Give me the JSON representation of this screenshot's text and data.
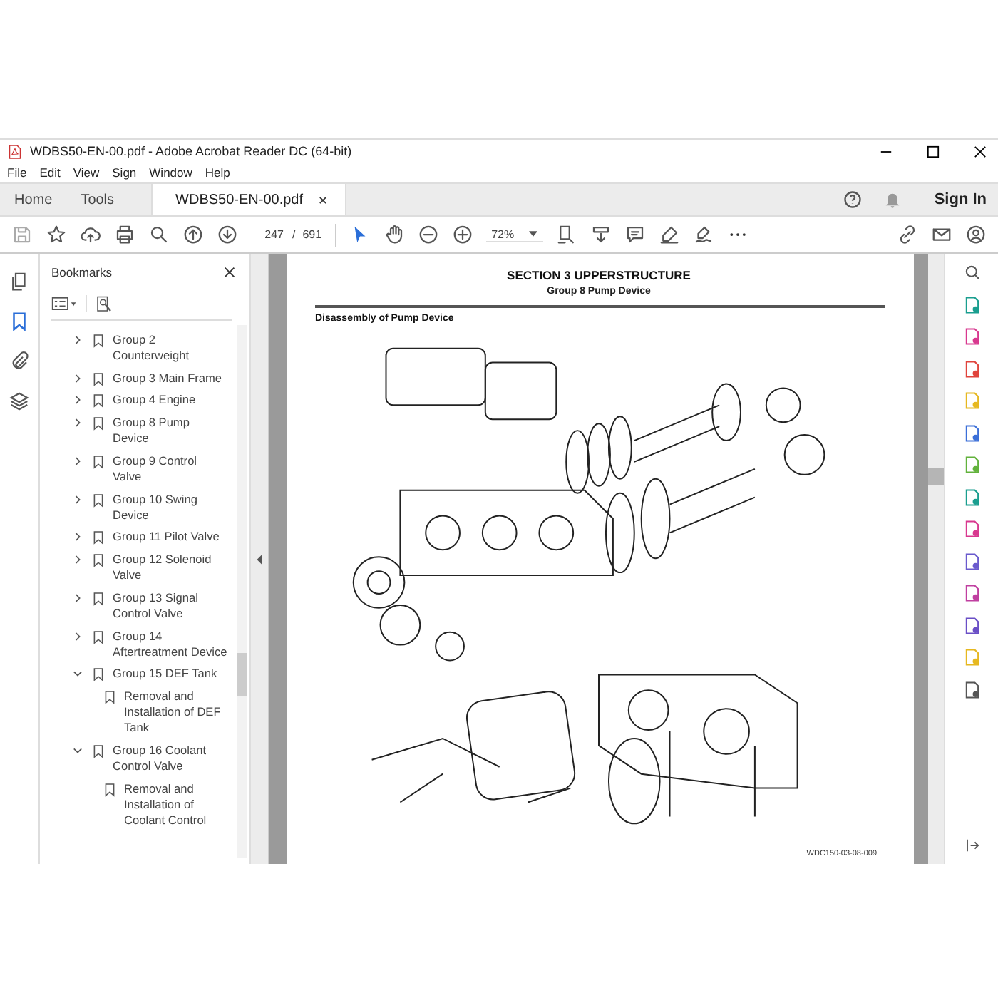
{
  "window": {
    "title": "WDBS50-EN-00.pdf - Adobe Acrobat Reader DC (64-bit)"
  },
  "menu": [
    "File",
    "Edit",
    "View",
    "Sign",
    "Window",
    "Help"
  ],
  "tabs": [
    {
      "label": "Home",
      "selected": false,
      "closable": false
    },
    {
      "label": "Tools",
      "selected": false,
      "closable": false
    },
    {
      "label": "WDBS50-EN-00.pdf",
      "selected": true,
      "closable": true
    }
  ],
  "sign_in": "Sign In",
  "toolbar": {
    "page": "247",
    "page_separator": "/",
    "page_count": "691",
    "zoom": "72%"
  },
  "bookmarks": {
    "title": "Bookmarks",
    "items": [
      {
        "label": "Group 2 Counterweight",
        "expanded": false
      },
      {
        "label": "Group 3 Main Frame",
        "expanded": false
      },
      {
        "label": "Group 4 Engine",
        "expanded": false
      },
      {
        "label": "Group 8 Pump Device",
        "expanded": false
      },
      {
        "label": "Group 9 Control Valve",
        "expanded": false
      },
      {
        "label": "Group 10 Swing Device",
        "expanded": false
      },
      {
        "label": "Group 11 Pilot Valve",
        "expanded": false
      },
      {
        "label": "Group 12 Solenoid Valve",
        "expanded": false
      },
      {
        "label": "Group 13 Signal Control Valve",
        "expanded": false
      },
      {
        "label": "Group 14 Aftertreatment Device",
        "expanded": false
      },
      {
        "label": "Group 15 DEF Tank",
        "expanded": true,
        "children": [
          {
            "label": "Removal and Installation of DEF Tank"
          }
        ]
      },
      {
        "label": "Group 16 Coolant Control Valve",
        "expanded": true,
        "children": [
          {
            "label": "Removal and Installation of Coolant Control"
          }
        ]
      }
    ]
  },
  "page": {
    "section": "SECTION 3 UPPERSTRUCTURE",
    "group": "Group 8 Pump Device",
    "heading": "Disassembly of Pump Device",
    "figure_code": "WDC150-03-08-009"
  }
}
